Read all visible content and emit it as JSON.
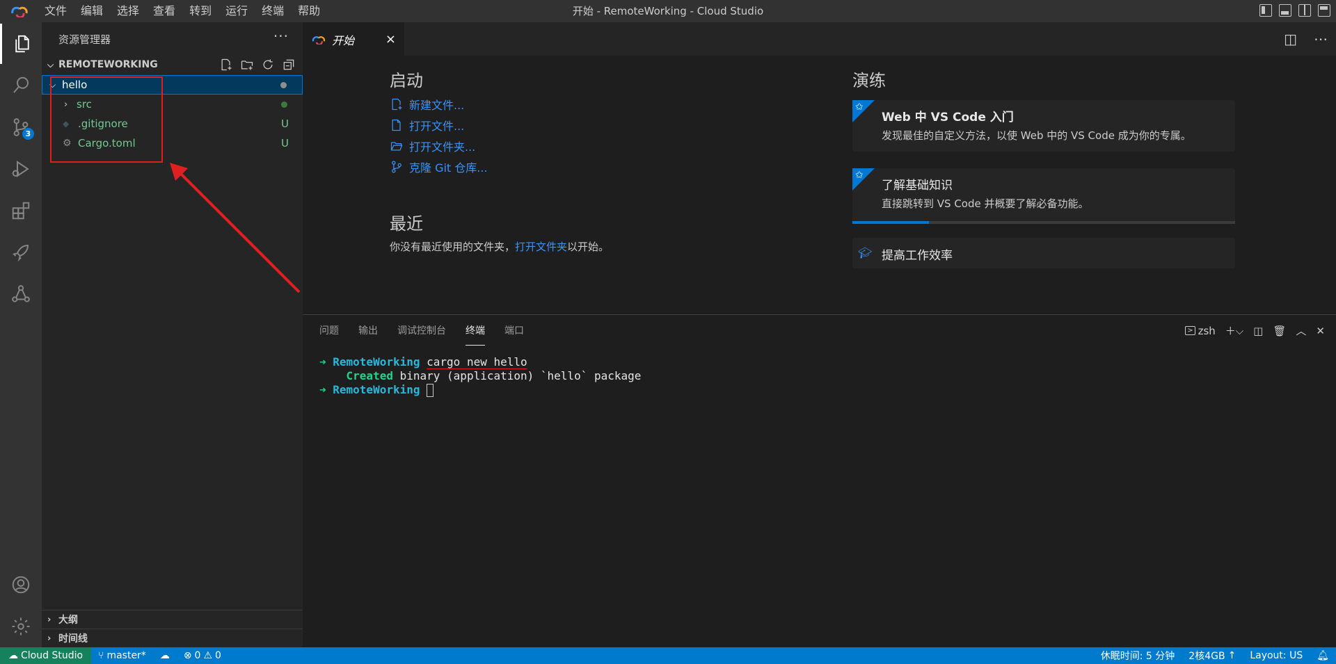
{
  "window": {
    "title": "开始 - RemoteWorking - Cloud Studio"
  },
  "menu": [
    "文件",
    "编辑",
    "选择",
    "查看",
    "转到",
    "运行",
    "终端",
    "帮助"
  ],
  "activity": {
    "scm_badge": "3"
  },
  "sidebar": {
    "title": "资源管理器",
    "more": "···",
    "folder": "REMOTEWORKING",
    "tree": [
      {
        "name": "hello",
        "type": "folder",
        "status": "dot"
      },
      {
        "name": "src",
        "type": "folder",
        "status": "dot-green"
      },
      {
        "name": ".gitignore",
        "type": "file",
        "status": "U"
      },
      {
        "name": "Cargo.toml",
        "type": "file",
        "status": "U"
      }
    ],
    "outline": "大纲",
    "timeline": "时间线"
  },
  "editor": {
    "tab_label": "开始",
    "start": {
      "heading": "启动",
      "links": [
        "新建文件...",
        "打开文件...",
        "打开文件夹...",
        "克隆 Git 仓库..."
      ]
    },
    "recent": {
      "heading": "最近",
      "text_before": "你没有最近使用的文件夹，",
      "link": "打开文件夹",
      "text_after": "以开始。"
    },
    "walkthroughs": {
      "heading": "演练",
      "cards": [
        {
          "title": "Web 中 VS Code 入门",
          "desc": "发现最佳的自定义方法，以使 Web 中的 VS Code 成为你的专属。"
        },
        {
          "title": "了解基础知识",
          "desc": "直接跳转到 VS Code 并概要了解必备功能。",
          "progress": 0.2
        },
        {
          "title": "提高工作效率"
        }
      ]
    }
  },
  "panel": {
    "tabs": [
      "问题",
      "输出",
      "调试控制台",
      "终端",
      "端口"
    ],
    "active_tab": "终端",
    "shell": "zsh",
    "terminal": {
      "line1_dir": "RemoteWorking",
      "line1_cmd": "cargo new hello",
      "line2_created": "Created",
      "line2_rest": "binary (application) `hello` package",
      "line3_dir": "RemoteWorking"
    }
  },
  "status": {
    "remote": "Cloud Studio",
    "branch": "master*",
    "errors": "0",
    "warnings": "0",
    "sleep": "休眠时间: 5 分钟",
    "machine": "2核4GB",
    "layout": "Layout: US"
  },
  "colors": {
    "accent": "#007acc",
    "annotation": "#e02020",
    "link": "#3794ff",
    "git_untracked": "#73c991"
  }
}
